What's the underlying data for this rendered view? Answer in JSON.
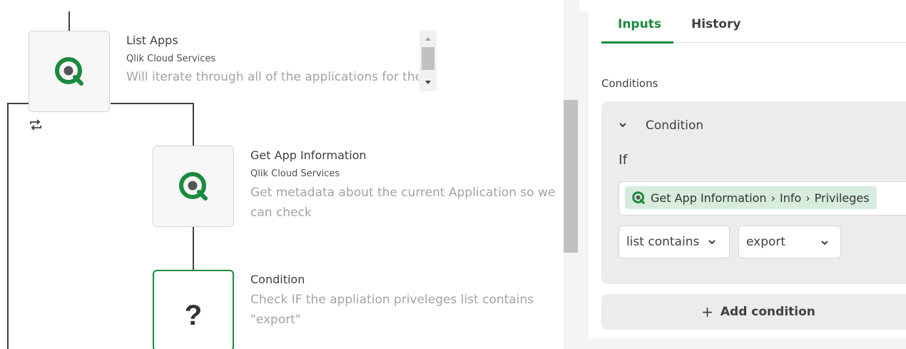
{
  "colors": {
    "accent": "#1a8a3f",
    "chip": "#d7ecdc",
    "desc": "#a3a3a3"
  },
  "flow": {
    "nodes": [
      {
        "title": "List Apps",
        "service": "Qlik Cloud Services",
        "description": "Will iterate through all of the applications for the",
        "icon": "qlik-logo-icon"
      },
      {
        "title": "Get App Information",
        "service": "Qlik Cloud Services",
        "description_lines": [
          "Get metadata about the current Application so we",
          "can check"
        ],
        "icon": "qlik-logo-icon"
      },
      {
        "title": "Condition",
        "description_lines": [
          "Check IF the appliation priveleges list contains",
          "\"export\""
        ],
        "icon": "question-mark-icon",
        "symbol": "?"
      }
    ],
    "loop_icon": "loop-icon"
  },
  "panel": {
    "tabs": [
      {
        "label": "Inputs",
        "active": true
      },
      {
        "label": "History",
        "active": false
      }
    ],
    "section_label": "Conditions",
    "condition": {
      "header": "Condition",
      "if_label": "If",
      "path": [
        "Get App Information",
        "Info",
        "Privileges"
      ],
      "operator": "list contains",
      "value": "export"
    },
    "add_condition_label": "Add condition",
    "add_symbol": "+"
  }
}
